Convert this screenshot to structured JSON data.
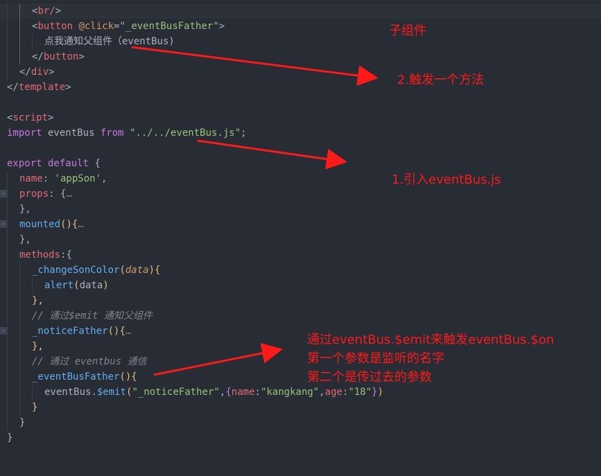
{
  "code_lines": [
    [
      "&lt;br/&gt;"
    ],
    [
      "<button @click=\"_eventBusFather\">"
    ],
    [
      "点我通知父组件（eventBus)"
    ],
    [
      "</button>"
    ],
    [
      "</div>"
    ],
    [
      "</template>"
    ],
    [
      ""
    ],
    [
      "<script>"
    ],
    [
      "import eventBus from \"../../eventBus.js\";"
    ],
    [
      ""
    ],
    [
      "export default {"
    ],
    [
      "name: 'appSon',"
    ],
    [
      "props: {…"
    ],
    [
      "},"
    ],
    [
      "mounted(){…"
    ],
    [
      "},"
    ],
    [
      "methods:{"
    ],
    [
      "_changeSonColor(data){"
    ],
    [
      "alert(data)"
    ],
    [
      "},"
    ],
    [
      "// 通过$emit 通知父组件"
    ],
    [
      "_noticeFather(){…"
    ],
    [
      "},"
    ],
    [
      "// 通过 eventbus 通信"
    ],
    [
      "_eventBusFather(){"
    ],
    [
      "eventBus.$emit(\"_noticeFather\",{name:\"kangkang\",age:\"18\"})"
    ],
    [
      "}"
    ],
    [
      "}"
    ],
    [
      "}"
    ]
  ],
  "tokens": {
    "br_open": "<",
    "br_name": "br/",
    "br_close": ">",
    "button_open": "<",
    "button_name": "button",
    "click_attr": " @click",
    "eq": "=",
    "click_val": "\"_eventBusFather\"",
    "gt": ">",
    "button_text": "点我通知父组件（eventBus)",
    "button_end_open": "</",
    "button_end_name": "button",
    "button_end_close": ">",
    "div_end_open": "</",
    "div_end_name": "div",
    "div_end_close": ">",
    "template_end_open": "</",
    "template_end_name": "template",
    "template_end_close": ">",
    "script_open": "<",
    "script_name": "script",
    "script_close": ">",
    "import_kw": "import",
    "import_ident": " eventBus ",
    "from_kw": "from",
    "import_path": " \"../../eventBus.js\"",
    "semicolon": ";",
    "export_kw": "export",
    "default_kw": " default",
    "open_brace": " {",
    "name_key": "name",
    "name_colon": ": ",
    "name_val": "'appSon'",
    "comma": ",",
    "props_key": "props",
    "props_rest": ": {",
    "ellipsis": "…",
    "close_comma": "},",
    "mounted_fn": "mounted",
    "mounted_paren": "()",
    "mounted_brace": "{",
    "methods_key": "methods",
    "methods_rest": ":{",
    "change_fn": "_changeSonColor",
    "change_open": "(",
    "change_param": "data",
    "change_close": ")",
    "change_brace": "{",
    "alert_fn": "alert",
    "alert_open": "(",
    "alert_arg": "data",
    "alert_close": ")",
    "comment1": "// 通过$emit 通知父组件",
    "notice_fn": "_noticeFather",
    "notice_paren": "()",
    "notice_brace": "{",
    "comment2": "// 通过 eventbus 通信",
    "ebf_fn": "_eventBusFather",
    "ebf_paren": "()",
    "ebf_brace": "{",
    "emit_obj": "eventBus",
    "emit_dot": ".",
    "emit_fn": "$emit",
    "emit_open": "(",
    "emit_str1": "\"_noticeFather\"",
    "emit_comma": ",",
    "emit_obrace": "{",
    "emit_k1": "name",
    "emit_c1": ":",
    "emit_v1": "\"kangkang\"",
    "emit_comma2": ",",
    "emit_k2": "age",
    "emit_c2": ":",
    "emit_v2": "\"18\"",
    "emit_cbrace": "}",
    "emit_close": ")",
    "close_brace": "}"
  },
  "annotations": {
    "child_component": "子组件",
    "step2": "2.触发一个方法",
    "step1": "1.引入eventBus.js",
    "note_line1": "通过eventBus.$emit来触发eventBus.$on",
    "note_line2": "第一个参数是监听的名字",
    "note_line3": "第二个是传过去的参数"
  },
  "fold_markers": {
    "props": "-",
    "mounted": "-",
    "notice": "-"
  },
  "colors": {
    "background": "#282c34",
    "annotation_red": "#ff1a1a",
    "tag": "#e06c75",
    "keyword": "#c678dd",
    "string": "#98c379",
    "function": "#61afef",
    "comment": "#7f848e"
  }
}
